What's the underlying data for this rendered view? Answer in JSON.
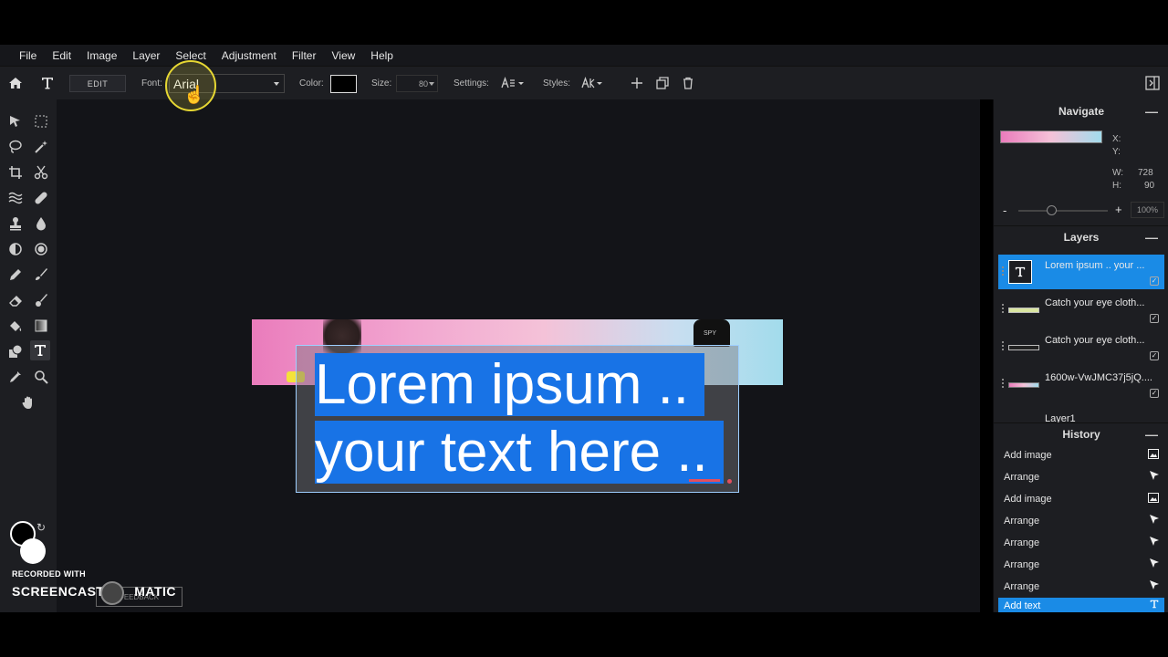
{
  "menu": [
    "File",
    "Edit",
    "Image",
    "Layer",
    "Select",
    "Adjustment",
    "Filter",
    "View",
    "Help"
  ],
  "toolbar": {
    "edit_label": "EDIT",
    "font_label": "Font:",
    "font_value": "Arial",
    "color_label": "Color:",
    "color_value": "#000000",
    "size_label": "Size:",
    "size_value": "80",
    "settings_label": "Settings:",
    "styles_label": "Styles:"
  },
  "canvas": {
    "text_line1": "Lorem ipsum .. ",
    "text_line2": "your text here .. ",
    "image_badge": "SPY"
  },
  "navigate": {
    "title": "Navigate",
    "x_label": "X:",
    "y_label": "Y:",
    "w_label": "W:",
    "w_value": "728",
    "h_label": "H:",
    "h_value": "90",
    "zoom_minus": "-",
    "zoom_plus": "+",
    "zoom_value": "100%"
  },
  "layers": {
    "title": "Layers",
    "items": [
      {
        "name": "Lorem ipsum .. your ...",
        "active": true
      },
      {
        "name": "Catch your eye cloth...",
        "active": false
      },
      {
        "name": "Catch your eye cloth...",
        "active": false
      },
      {
        "name": "1600w-VwJMC37j5jQ....",
        "active": false
      },
      {
        "name": "Layer1",
        "active": false
      }
    ]
  },
  "history": {
    "title": "History",
    "items": [
      {
        "label": "Add image",
        "icon": "image-icon"
      },
      {
        "label": "Arrange",
        "icon": "arrow-cursor-icon"
      },
      {
        "label": "Add image",
        "icon": "image-icon"
      },
      {
        "label": "Arrange",
        "icon": "arrow-cursor-icon"
      },
      {
        "label": "Arrange",
        "icon": "arrow-cursor-icon"
      },
      {
        "label": "Arrange",
        "icon": "arrow-cursor-icon"
      },
      {
        "label": "Arrange",
        "icon": "arrow-cursor-icon"
      },
      {
        "label": "Add text",
        "icon": "text-icon"
      }
    ]
  },
  "watermark": {
    "line1": "RECORDED WITH",
    "line2": "SCREENCAST",
    "line2b": "MATIC",
    "feedback": "FEEDBACK"
  },
  "colors": {
    "accent": "#1a8be6",
    "text_highlight": "#1873e6",
    "panel_bg": "#1d1e22",
    "workspace_bg": "#131418",
    "foreground": "#000000",
    "background": "#ffffff"
  }
}
